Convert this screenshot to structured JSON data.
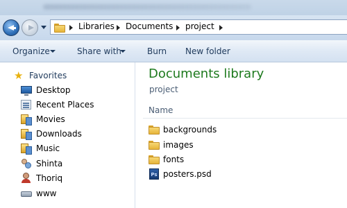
{
  "address": {
    "crumbs": [
      "Libraries",
      "Documents",
      "project"
    ]
  },
  "toolbar": {
    "organize": "Organize",
    "share_with": "Share with",
    "burn": "Burn",
    "new_folder": "New folder"
  },
  "sidebar": {
    "favorites": "Favorites",
    "items": [
      {
        "label": "Desktop",
        "icon": "desktop-icon"
      },
      {
        "label": "Recent Places",
        "icon": "recent-places-icon"
      },
      {
        "label": "Movies",
        "icon": "library-icon"
      },
      {
        "label": "Downloads",
        "icon": "library-icon"
      },
      {
        "label": "Music",
        "icon": "library-icon"
      },
      {
        "label": "Shinta",
        "icon": "users-icon"
      },
      {
        "label": "Thoriq",
        "icon": "user-icon"
      },
      {
        "label": "www",
        "icon": "network-drive-icon"
      }
    ]
  },
  "main": {
    "title": "Documents library",
    "subtitle": "project",
    "column_name": "Name",
    "files": [
      {
        "label": "backgrounds",
        "icon": "folder-icon"
      },
      {
        "label": "images",
        "icon": "folder-icon"
      },
      {
        "label": "fonts",
        "icon": "folder-icon"
      },
      {
        "label": "posters.psd",
        "icon": "photoshop-file-icon",
        "badge": "Ps"
      }
    ]
  },
  "colors": {
    "library_title": "#1e7a1e",
    "toolbar_text": "#1e395b"
  }
}
